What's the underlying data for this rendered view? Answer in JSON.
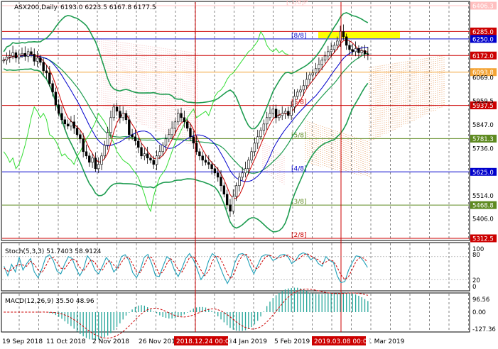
{
  "header": {
    "symbol": "ASX200,Daily",
    "ohlc": "6193.0 6223.5 6167.8 6177.5"
  },
  "colors": {
    "background": "#ffffff",
    "candle": "#000000",
    "bollinger": "#1e9c50",
    "kijun": "#0000cc",
    "tenkan": "#cc0000",
    "chikou": "#33dd33",
    "cloud": "#e07a2a",
    "stoch_main": "#1fa0b8",
    "stoch_signal": "#cc0000",
    "macd_hist": "#26a69a",
    "macd_signal": "#cc0000",
    "highlight": "#ffff00",
    "vline": "#cc0000"
  },
  "murrey_levels": [
    {
      "label": "[-1/8]P",
      "price": 6406.3,
      "tag": "6406.3",
      "line_color": "#ffc0c0",
      "tag_bg": "#ffc0c0",
      "tag_fg": "#ffffff"
    },
    {
      "label": "",
      "price": 6285.0,
      "tag": "6285.0",
      "line_color": "#cc0000",
      "tag_bg": "#cc0000",
      "tag_fg": "#ffffff"
    },
    {
      "label": "[8/8]",
      "price": 6250.0,
      "tag": "6250.0",
      "line_color": "#0000cc",
      "tag_bg": "#0000cc",
      "tag_fg": "#ffffff"
    },
    {
      "label": "",
      "price": 6172.0,
      "tag": "6172.0",
      "line_color": "#cc0000",
      "tag_bg": "#cc0000",
      "tag_fg": "#ffffff"
    },
    {
      "label": "",
      "price": 6093.8,
      "tag": "6093.8",
      "line_color": "#f4a436",
      "tag_bg": "#f4a436",
      "tag_fg": "#ffffff"
    },
    {
      "label": "[6/8]",
      "price": 5937.5,
      "tag": "5937.5",
      "line_color": "#cc0000",
      "tag_bg": "#cc0000",
      "tag_fg": "#ffffff"
    },
    {
      "label": "[5/8]",
      "price": 5781.3,
      "tag": "5781.3",
      "line_color": "#5e8a20",
      "tag_bg": "#5e8a20",
      "tag_fg": "#ffffff"
    },
    {
      "label": "[4/8]",
      "price": 5625.0,
      "tag": "5625.0",
      "line_color": "#0000cc",
      "tag_bg": "#0000cc",
      "tag_fg": "#ffffff"
    },
    {
      "label": "[3/8]",
      "price": 5468.8,
      "tag": "5468.8",
      "line_color": "#5e8a20",
      "tag_bg": "#5e8a20",
      "tag_fg": "#ffffff"
    },
    {
      "label": "[2/8]",
      "price": 5312.5,
      "tag": "5312.5",
      "line_color": "#cc0000",
      "tag_bg": "#cc0000",
      "tag_fg": "#ffffff"
    }
  ],
  "price_ticks": [
    "6069.0",
    "5959.5",
    "5847.0",
    "5736.0",
    "5514.0",
    "5406.0"
  ],
  "x_ticks": [
    "19 Sep 2018",
    "11 Oct 2018",
    "2 Nov 2018",
    "26 Nov 2018",
    "14 Jan 2019",
    "5 Feb 2019",
    "1 Mar 2019"
  ],
  "x_markers": [
    "2018.12.24 00:00",
    "2019.03.08 00:00"
  ],
  "stoch": {
    "label": "Stoch(5,3,3) 51.7403 58.9124",
    "ticks": [
      "100",
      "80",
      "20",
      "0"
    ]
  },
  "macd": {
    "label": "MACD(12,26,9) 35.50 48.96",
    "ticks": [
      "96.56",
      "0.00",
      "-127.36"
    ]
  },
  "chart_data": {
    "type": "candlestick",
    "title": "ASX200,Daily",
    "ylim": [
      5312.5,
      6406.3
    ],
    "series_close": [
      6150,
      6165,
      6170,
      6185,
      6160,
      6175,
      6182,
      6168,
      6190,
      6178,
      6145,
      6160,
      6140,
      6100,
      6090,
      6040,
      6000,
      5940,
      5900,
      5870,
      5850,
      5840,
      5860,
      5830,
      5800,
      5780,
      5720,
      5700,
      5670,
      5690,
      5640,
      5660,
      5700,
      5750,
      5810,
      5880,
      5930,
      5910,
      5880,
      5900,
      5870,
      5800,
      5790,
      5770,
      5740,
      5700,
      5710,
      5690,
      5680,
      5660,
      5700,
      5720,
      5750,
      5780,
      5800,
      5830,
      5860,
      5900,
      5880,
      5860,
      5830,
      5790,
      5760,
      5720,
      5700,
      5680,
      5670,
      5660,
      5640,
      5620,
      5600,
      5560,
      5520,
      5470,
      5440,
      5510,
      5560,
      5600,
      5620,
      5640,
      5680,
      5720,
      5760,
      5790,
      5820,
      5850,
      5880,
      5900,
      5920,
      5880,
      5890,
      5900,
      5910,
      5890,
      5930,
      5980,
      6000,
      6010,
      6030,
      6060,
      6080,
      6090,
      6110,
      6130,
      6150,
      6170,
      6190,
      6200,
      6220,
      6240,
      6285,
      6260,
      6220,
      6200,
      6190,
      6205,
      6185,
      6195,
      6180,
      6177.5
    ],
    "stoch_main": [
      55,
      30,
      60,
      40,
      78,
      45,
      62,
      75,
      40,
      25,
      48,
      78,
      85,
      70,
      42,
      35,
      60,
      80,
      75,
      50,
      30,
      48,
      82,
      70,
      45,
      35,
      55,
      78,
      65,
      40,
      52,
      80,
      85,
      70,
      38,
      25,
      45,
      78,
      86,
      62,
      30,
      28,
      55,
      80,
      72,
      45,
      28,
      50,
      76,
      88,
      72,
      48,
      20,
      35,
      68,
      88,
      80,
      55,
      30,
      10,
      30,
      65,
      86,
      88,
      82,
      55,
      35,
      58,
      80,
      85,
      84,
      70,
      75,
      84,
      86,
      80,
      62,
      70,
      85,
      90,
      86,
      72,
      78,
      62,
      55,
      80,
      70,
      65,
      30,
      12,
      15,
      45,
      65,
      82,
      80,
      68,
      52
    ],
    "stoch_signal": [
      50,
      42,
      45,
      55,
      60,
      58,
      55,
      68,
      60,
      45,
      38,
      55,
      75,
      78,
      65,
      50,
      48,
      62,
      75,
      70,
      52,
      42,
      58,
      72,
      65,
      48,
      45,
      62,
      70,
      58,
      48,
      65,
      78,
      78,
      60,
      40,
      38,
      58,
      78,
      78,
      55,
      35,
      40,
      62,
      75,
      65,
      45,
      40,
      58,
      78,
      80,
      65,
      45,
      30,
      42,
      68,
      82,
      78,
      58,
      35,
      22,
      42,
      68,
      84,
      86,
      72,
      52,
      48,
      65,
      78,
      84,
      80,
      76,
      78,
      82,
      84,
      76,
      70,
      75,
      84,
      88,
      82,
      76,
      72,
      62,
      66,
      72,
      68,
      52,
      32,
      20,
      28,
      48,
      68,
      78,
      76,
      66
    ]
  }
}
